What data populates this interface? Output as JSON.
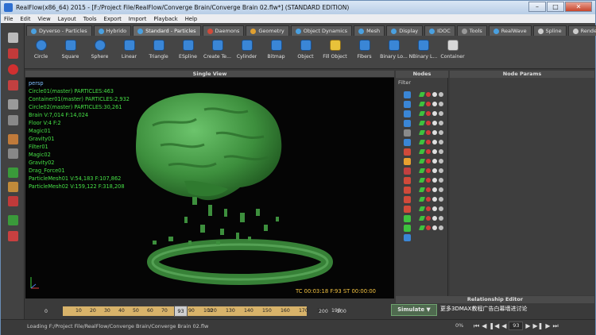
{
  "window": {
    "title": "RealFlow(x86_64) 2015 - [F:/Project File/RealFlow/Converge Brain/Converge Brain 02.flw*] (STANDARD EDITION)",
    "minimize": "–",
    "maximize": "□",
    "close": "✕"
  },
  "menu": [
    "File",
    "Edit",
    "View",
    "Layout",
    "Tools",
    "Export",
    "Import",
    "Playback",
    "Help"
  ],
  "tabs": [
    {
      "label": "Dyverso - Particles",
      "active": false
    },
    {
      "label": "Hybrido",
      "active": false
    },
    {
      "label": "Standard - Particles",
      "active": true
    },
    {
      "label": "Daemons",
      "active": false
    },
    {
      "label": "Geometry",
      "active": false
    },
    {
      "label": "Object Dynamics",
      "active": false
    },
    {
      "label": "Mesh",
      "active": false
    },
    {
      "label": "Display",
      "active": false
    },
    {
      "label": "IDOC",
      "active": false
    },
    {
      "label": "Tools",
      "active": false
    },
    {
      "label": "RealWave",
      "active": false
    },
    {
      "label": "Spline",
      "active": false
    },
    {
      "label": "Render",
      "active": false
    }
  ],
  "tools": [
    "Circle",
    "Square",
    "Sphere",
    "Linear",
    "Triangle",
    "ESpline",
    "Create Te...",
    "Cylinder",
    "Bitmap",
    "Object",
    "Fill Object",
    "Fibers",
    "Binary Lo...",
    "NBinary L...",
    "Container"
  ],
  "viewport": {
    "title": "Single View",
    "camera": "persp",
    "stats": [
      "Circle01(master) PARTICLES:463",
      "Container01(master) PARTICLES:2,932",
      "Circle02(master) PARTICLES:30,261",
      "Brain V:7,014 F:14,024",
      "Floor V:4 F:2",
      "Magic01",
      "Gravity01",
      "Filter01",
      "Magic02",
      "Gravity02",
      "Drag_Force01",
      "ParticleMesh01 V:54,183 F:107,862",
      "ParticleMesh02 V:159,122 F:318,208"
    ],
    "timecode": "TC 00:03:18   F:93   ST 00:00:00"
  },
  "nodes": {
    "title": "Nodes",
    "filter_label": "Filter"
  },
  "node_params": {
    "title": "Node Params"
  },
  "relationship_editor": {
    "title": "Relationship Editor"
  },
  "timeline": {
    "start": "0",
    "ticks": [
      "10",
      "20",
      "30",
      "40",
      "50",
      "60",
      "70",
      "80",
      "90",
      "100",
      "110",
      "120",
      "130",
      "140",
      "150",
      "160",
      "170",
      "180",
      "190"
    ],
    "current_frame": "93",
    "end1": "200",
    "end2": "200"
  },
  "simulate_label": "Simulate ▼",
  "watermark": "更多3DMAX教程广告白幕墙进讨论",
  "status": {
    "message": "Loading F:/Project File/RealFlow/Converge Brain/Converge Brain 02.flw",
    "progress": "0%",
    "frame": "93"
  },
  "colors": {
    "stats_text": "#46e046",
    "brain": "#3d8f3d",
    "timecode": "#f0c040",
    "timeline_range": "#d8b36a"
  }
}
